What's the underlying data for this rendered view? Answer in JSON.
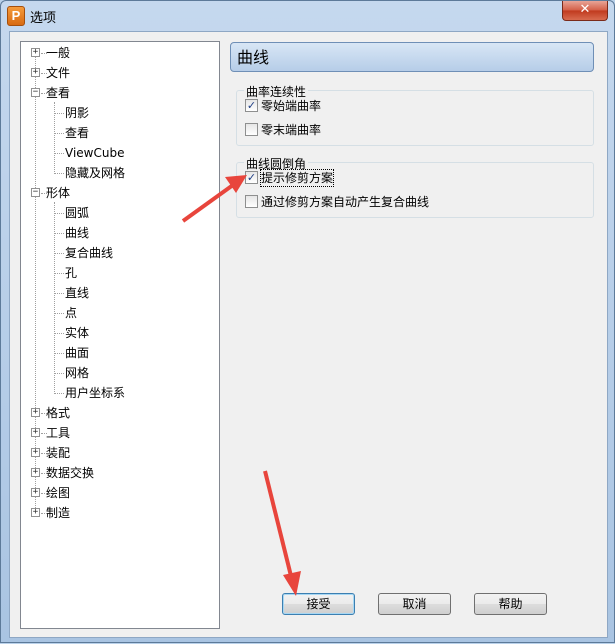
{
  "window": {
    "title": "选项",
    "app_icon_letter": "P",
    "close_symbol": "✕"
  },
  "tree": {
    "items": [
      {
        "label": "一般",
        "expander": "+"
      },
      {
        "label": "文件",
        "expander": "+"
      },
      {
        "label": "查看",
        "expander": "−"
      },
      {
        "label": "阴影"
      },
      {
        "label": "查看"
      },
      {
        "label": "ViewCube"
      },
      {
        "label": "隐藏及网格"
      },
      {
        "label": "形体",
        "expander": "−"
      },
      {
        "label": "圆弧"
      },
      {
        "label": "曲线"
      },
      {
        "label": "复合曲线"
      },
      {
        "label": "孔"
      },
      {
        "label": "直线"
      },
      {
        "label": "点"
      },
      {
        "label": "实体"
      },
      {
        "label": "曲面"
      },
      {
        "label": "网格"
      },
      {
        "label": "用户坐标系"
      },
      {
        "label": "格式",
        "expander": "+"
      },
      {
        "label": "工具",
        "expander": "+"
      },
      {
        "label": "装配",
        "expander": "+"
      },
      {
        "label": "数据交换",
        "expander": "+"
      },
      {
        "label": "绘图",
        "expander": "+"
      },
      {
        "label": "制造",
        "expander": "+"
      }
    ]
  },
  "panel": {
    "title": "曲线",
    "group1": {
      "title": "曲率连续性",
      "options": [
        {
          "label": "零始端曲率",
          "checked": "✓"
        },
        {
          "label": "零末端曲率",
          "checked": ""
        }
      ]
    },
    "group2": {
      "title": "曲线圆倒角",
      "options": [
        {
          "label": "提示修剪方案",
          "checked": "✓"
        },
        {
          "label": "通过修剪方案自动产生复合曲线",
          "checked": ""
        }
      ]
    }
  },
  "buttons": {
    "accept": "接受",
    "cancel": "取消",
    "help": "帮助"
  },
  "accent": {
    "arrow": "#e8453c",
    "header_border": "#6f8fb6"
  }
}
